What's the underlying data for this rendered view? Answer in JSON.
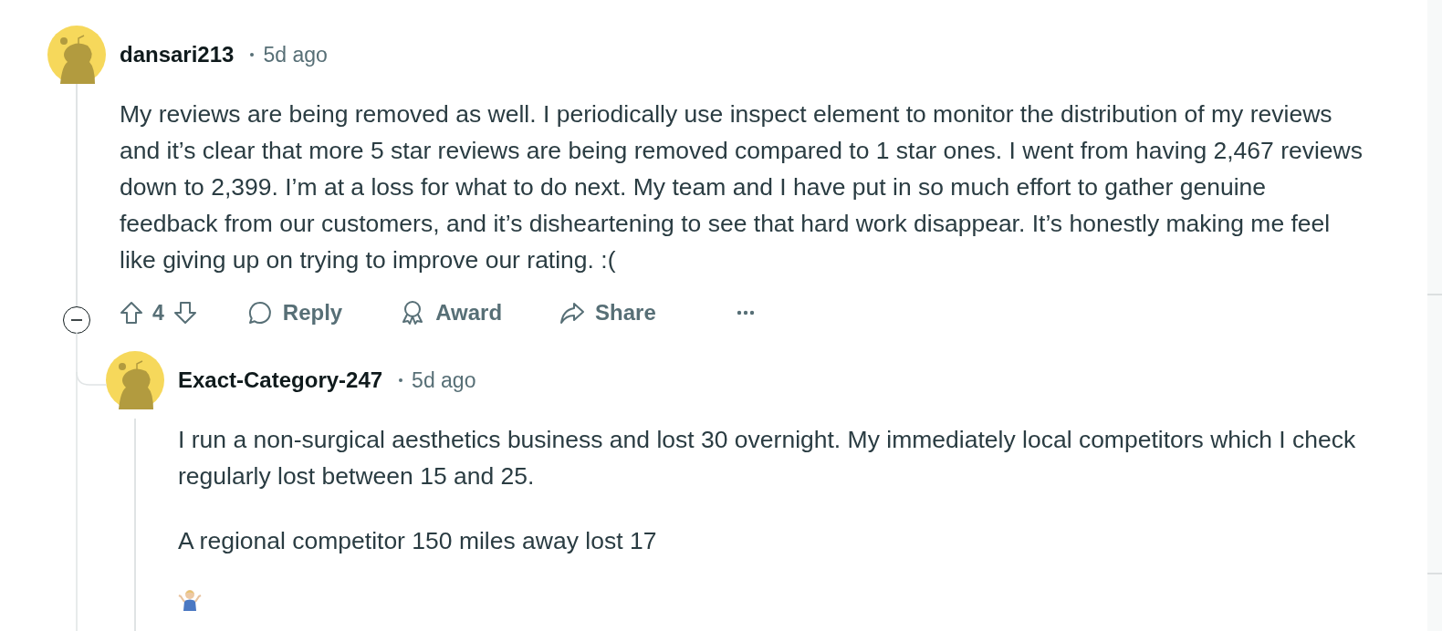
{
  "comments": [
    {
      "author": "dansari213",
      "time": "5d ago",
      "expanded": true,
      "paragraphs": [
        {
          "kind": "text",
          "text": "My reviews are being removed as well. I periodically use inspect element to monitor the distribution of my reviews and it’s clear that more 5 star reviews are being removed compared to 1 star ones. I went from having 2,467 reviews down to 2,399. I’m at a loss for what to do next. My team and I have put in so much effort to gather genuine feedback from our customers, and it’s disheartening to see that hard work disappear. It’s honestly making me feel like giving up on trying to improve our rating. :("
        }
      ],
      "votes": "4",
      "actions": [
        {
          "kind": "reply",
          "label": "Reply"
        },
        {
          "kind": "award",
          "label": "Award"
        },
        {
          "kind": "share",
          "label": "Share"
        },
        {
          "kind": "more"
        }
      ],
      "replies": [
        {
          "author": "Exact-Category-247",
          "time": "5d ago",
          "paragraphs": [
            {
              "kind": "text",
              "text": "I run a non-surgical aesthetics business and lost 30 overnight. My immediately local competitors which I check regularly lost between 15 and 25."
            },
            {
              "kind": "text",
              "text": "A regional competitor 150 miles away lost 17"
            },
            {
              "kind": "shrug"
            }
          ]
        }
      ]
    }
  ]
}
